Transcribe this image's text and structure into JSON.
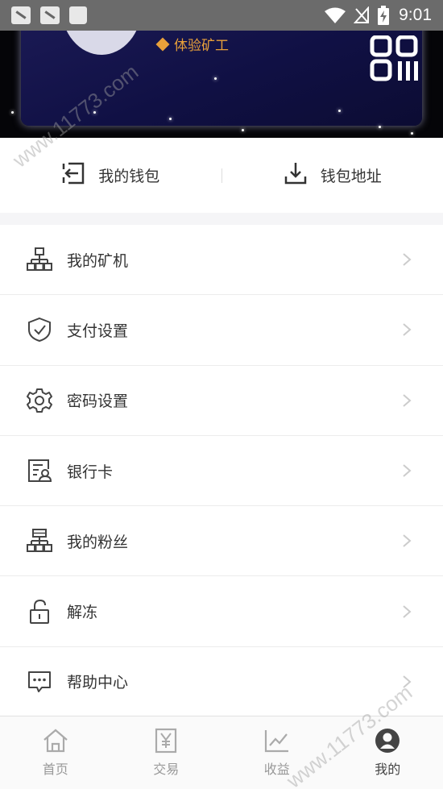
{
  "status_bar": {
    "time": "9:01",
    "icons": [
      "notification-icon",
      "notification-icon",
      "shopping-bag-icon",
      "wifi-icon",
      "no-signal-icon",
      "battery-charging-icon"
    ]
  },
  "hero": {
    "level_text": "体验矿工",
    "qr_icon": "qr-code-icon"
  },
  "wallet": {
    "my_wallet_label": "我的钱包",
    "my_wallet_icon": "wallet-login-icon",
    "address_label": "钱包地址",
    "address_icon": "download-icon"
  },
  "menu": {
    "items": [
      {
        "label": "我的矿机",
        "icon": "network-icon"
      },
      {
        "label": "支付设置",
        "icon": "shield-check-icon"
      },
      {
        "label": "密码设置",
        "icon": "gear-icon"
      },
      {
        "label": "银行卡",
        "icon": "id-card-icon"
      },
      {
        "label": "我的粉丝",
        "icon": "hierarchy-icon"
      },
      {
        "label": "解冻",
        "icon": "unlock-icon"
      },
      {
        "label": "帮助中心",
        "icon": "chat-icon"
      }
    ]
  },
  "tabbar": {
    "tabs": [
      {
        "label": "首页",
        "icon": "home-icon",
        "active": false
      },
      {
        "label": "交易",
        "icon": "yen-icon",
        "active": false
      },
      {
        "label": "收益",
        "icon": "chart-icon",
        "active": false
      },
      {
        "label": "我的",
        "icon": "user-icon",
        "active": true
      }
    ]
  },
  "watermark": {
    "text_top": "www.11773.com",
    "text_bottom": "www.11773.com"
  },
  "colors": {
    "accent": "#e8a03a",
    "hero_bg": "#101044",
    "text": "#333333",
    "muted": "#999999"
  }
}
